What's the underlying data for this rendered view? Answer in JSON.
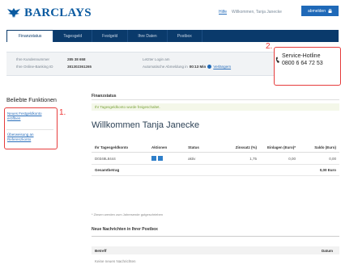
{
  "header": {
    "brand": "BARCLAYS",
    "help": "Hilfe",
    "welcome_text": "Willkommen, Tanja Janecke",
    "logout": "abmelden"
  },
  "nav": {
    "tabs": [
      {
        "label": "Finanzstatus",
        "active": true
      },
      {
        "label": "Tagesgeld",
        "active": false
      },
      {
        "label": "Festgeld",
        "active": false
      },
      {
        "label": "Ihre Daten",
        "active": false
      },
      {
        "label": "Postbox",
        "active": false
      }
    ]
  },
  "infobar": {
    "customer_no_label": "Ihre Kundennummer",
    "customer_no": "285 38 658",
    "online_id_label": "Ihre Online-Banking ID",
    "online_id": "381302361265",
    "last_login_label": "Letzter Login am",
    "auto_logout_text": "Automatische Abmeldung in",
    "auto_logout_time": "00:13 Min",
    "extend_link": "Verlängern"
  },
  "hotline": {
    "label": "Service-Hotline",
    "number": "0800 6 64 72 53"
  },
  "annotations": {
    "one": "1.",
    "two": "2."
  },
  "sidebar": {
    "title": "Beliebte Funktionen",
    "links": [
      "Neues Festgeldkonto eröffnen",
      "Überweisung an Referenzkonto"
    ]
  },
  "main": {
    "section_title": "Finanzstatus",
    "success_msg": "Ihr Tagesgeldkonto wurde freigeschaltet.",
    "welcome": "Willkommen Tanja Janecke",
    "table": {
      "headers": [
        "Ihr Tagesgeldkonto",
        "Aktionen",
        "Status",
        "Zinssatz (%)",
        "Einlagen (Euro)*",
        "Saldo (Euro)"
      ],
      "rows": [
        {
          "account": "D0348L8444",
          "status": "aktiv",
          "rate": "1,75",
          "deposits": "0,00",
          "balance": "0,00"
        }
      ],
      "total_label": "Gesamtbetrag",
      "total_value": "0,00 Euro"
    },
    "footnote": "* Zinsen werden zum Jahresende gutgeschrieben",
    "messages": {
      "title": "Neue Nachrichten in Ihrer Postbox",
      "col_subject": "Betreff",
      "col_date": "Datum",
      "empty": "Keine neuen Nachrichten"
    }
  },
  "colors": {
    "brand": "#0a5aa0",
    "nav": "#0a3a6b",
    "highlight": "#e63c3c"
  }
}
